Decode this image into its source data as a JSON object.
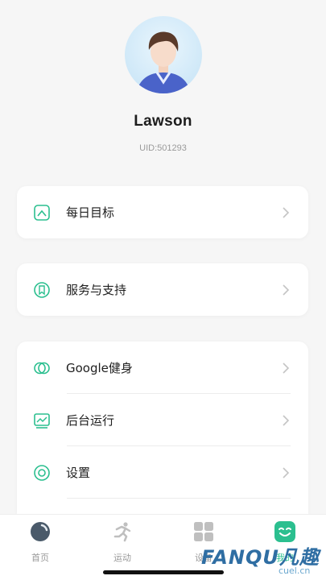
{
  "profile": {
    "username": "Lawson",
    "uid": "UID:501293"
  },
  "menu": {
    "daily_goal": "每日目标",
    "service_support": "服务与支持",
    "google_fit": "Google健身",
    "background_run": "后台运行",
    "settings": "设置"
  },
  "tabs": {
    "home": "首页",
    "sport": "运动",
    "device": "设备",
    "mine": "我的"
  },
  "watermark": {
    "brand": "FANQU凡趣",
    "site": "cuel.cn"
  },
  "colors": {
    "accent": "#2bbf8f",
    "tab_inactive": "#bfbfbf"
  }
}
